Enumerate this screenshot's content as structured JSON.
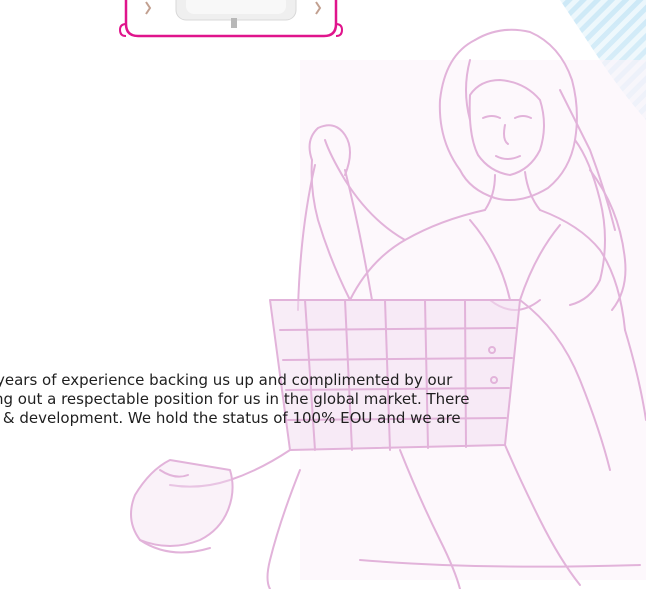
{
  "intro": {
    "lines": [
      "years of experience backing us up and complimented by our",
      "ng out a respectable position for us in the global market.  There",
      "l & development. We hold the status of 100% EOU and we are"
    ]
  },
  "colors": {
    "frame_border": "#e0148c",
    "sketch_ink": "#e2b3da",
    "pattern_blue": "#a9d8f0",
    "text": "#1f1f1f"
  },
  "icons": {
    "product_image": "white-bag-product-image",
    "model_sketch": "woman-with-handbag-sketch-illustration",
    "corner_pattern": "blue-diamond-pattern"
  }
}
